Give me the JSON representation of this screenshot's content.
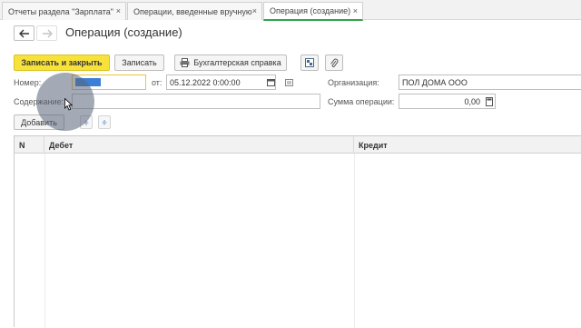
{
  "tabs": [
    {
      "label": "Отчеты раздела \"Зарплата\"",
      "close": "×"
    },
    {
      "label": "Операции, введенные вручную",
      "close": "×"
    },
    {
      "label": "Операция (создание)",
      "close": "×"
    }
  ],
  "nav": {
    "back_icon": "arrow-left-icon",
    "forward_icon": "arrow-right-icon"
  },
  "form": {
    "title": "Операция (создание)",
    "toolbar": {
      "save_close_label": "Записать и закрыть",
      "save_label": "Записать",
      "accounting_label": "Бухгалтерская справка"
    },
    "number_label": "Номер:",
    "number_value": "",
    "from_label": "от:",
    "date_value": "05.12.2022  0:00:00",
    "organization_label": "Организация:",
    "organization_value": "ПОЛ ДОМА ООО",
    "content_label": "Содержание:",
    "content_value": "",
    "sum_label": "Сумма операции:",
    "sum_value": "0,00",
    "add_label": "Добавить"
  },
  "table": {
    "columns": [
      "N",
      "Дебет",
      "Кредит"
    ],
    "rows": []
  },
  "colors": {
    "accent": "#f7e23b",
    "active_tab": "#2fa34b",
    "selection": "#3d7fd6"
  }
}
